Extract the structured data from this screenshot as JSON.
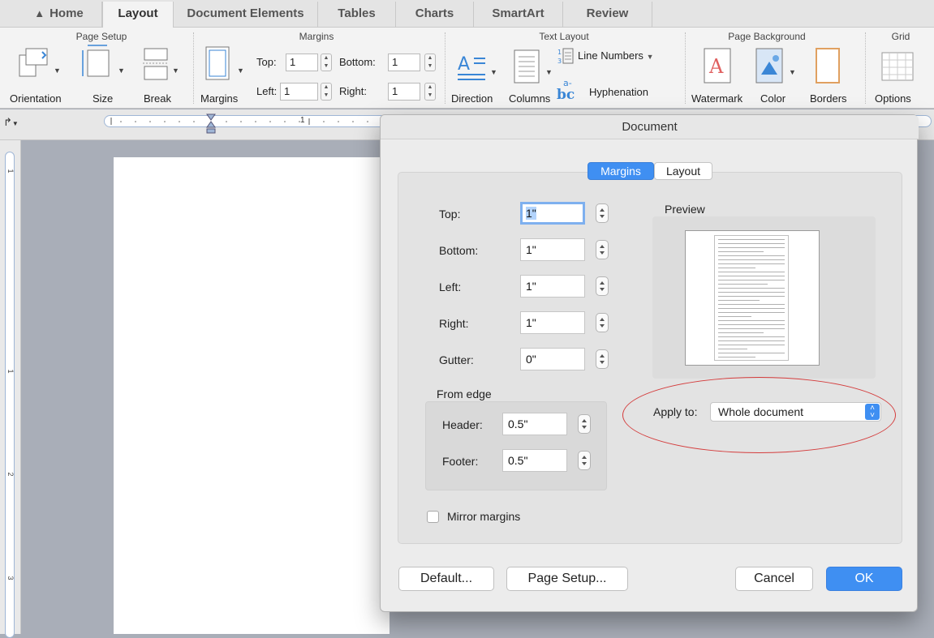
{
  "ribbon_tabs": [
    {
      "label": "Home"
    },
    {
      "label": "Layout"
    },
    {
      "label": "Document Elements"
    },
    {
      "label": "Tables"
    },
    {
      "label": "Charts"
    },
    {
      "label": "SmartArt"
    },
    {
      "label": "Review"
    }
  ],
  "ribbon": {
    "groups": {
      "page_setup": "Page Setup",
      "margins": "Margins",
      "text_layout": "Text Layout",
      "page_background": "Page Background",
      "grid": "Grid"
    },
    "buttons": {
      "orientation": "Orientation",
      "size": "Size",
      "break": "Break",
      "margins": "Margins",
      "direction": "Direction",
      "columns": "Columns",
      "line_numbers": "Line Numbers",
      "hyphenation": "Hyphenation",
      "watermark": "Watermark",
      "color": "Color",
      "borders": "Borders",
      "options": "Options"
    },
    "margin_fields": {
      "top_label": "Top:",
      "top_value": "1",
      "bottom_label": "Bottom:",
      "bottom_value": "1",
      "left_label": "Left:",
      "left_value": "1",
      "right_label": "Right:",
      "right_value": "1"
    }
  },
  "rulers": {
    "h_mark": "1",
    "v_marks": [
      "1",
      "1",
      "2",
      "3"
    ]
  },
  "dialog": {
    "title": "Document",
    "tabs": {
      "margins": "Margins",
      "layout": "Layout"
    },
    "fields": {
      "top": {
        "label": "Top:",
        "value": "1\""
      },
      "bottom": {
        "label": "Bottom:",
        "value": "1\""
      },
      "left": {
        "label": "Left:",
        "value": "1\""
      },
      "right": {
        "label": "Right:",
        "value": "1\""
      },
      "gutter": {
        "label": "Gutter:",
        "value": "0\""
      }
    },
    "from_edge": {
      "title": "From edge",
      "header": {
        "label": "Header:",
        "value": "0.5\""
      },
      "footer": {
        "label": "Footer:",
        "value": "0.5\""
      }
    },
    "preview_label": "Preview",
    "apply_to": {
      "label": "Apply to:",
      "value": "Whole document"
    },
    "mirror_margins": {
      "label": "Mirror margins",
      "checked": false
    },
    "buttons": {
      "default": "Default...",
      "page_setup": "Page Setup...",
      "cancel": "Cancel",
      "ok": "OK"
    }
  },
  "colors": {
    "accent": "#3f8ff2",
    "annotation": "#d43c3c"
  }
}
